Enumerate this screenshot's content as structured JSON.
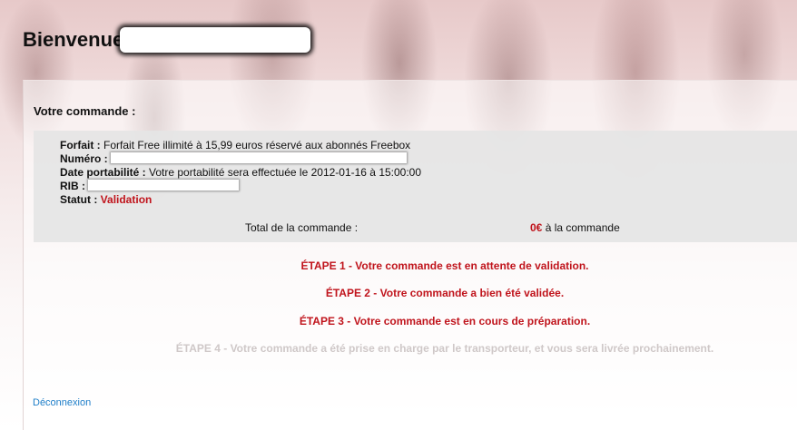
{
  "header": {
    "welcome": "Bienvenue"
  },
  "order": {
    "title": "Votre commande :",
    "forfait_label": "Forfait :",
    "forfait_value": "Forfait Free illimité à 15,99 euros réservé aux abonnés Freebox",
    "numero_label": "Numéro :",
    "date_label": "Date portabilité :",
    "date_value": "Votre portabilité sera effectuée le 2012-01-16 à 15:00:00",
    "rib_label": "RIB :",
    "statut_label": "Statut :",
    "statut_value": "Validation",
    "total_label": "Total de la commande :",
    "total_amount": "0€",
    "total_suffix": "à la commande"
  },
  "steps": [
    {
      "text": "ÉTAPE 1 - Votre commande est en attente de validation.",
      "active": true
    },
    {
      "text": "ÉTAPE 2 - Votre commande a bien été validée.",
      "active": true
    },
    {
      "text": "ÉTAPE 3 - Votre commande est en cours de préparation.",
      "active": true
    },
    {
      "text": "ÉTAPE 4 - Votre commande a été prise en charge par le transporteur, et vous sera livrée prochainement.",
      "active": false
    }
  ],
  "footer": {
    "logout": "Déconnexion"
  },
  "colors": {
    "accent_red": "#c0141c",
    "link_blue": "#1e7ec8",
    "box_grey": "#e5e5e5"
  }
}
